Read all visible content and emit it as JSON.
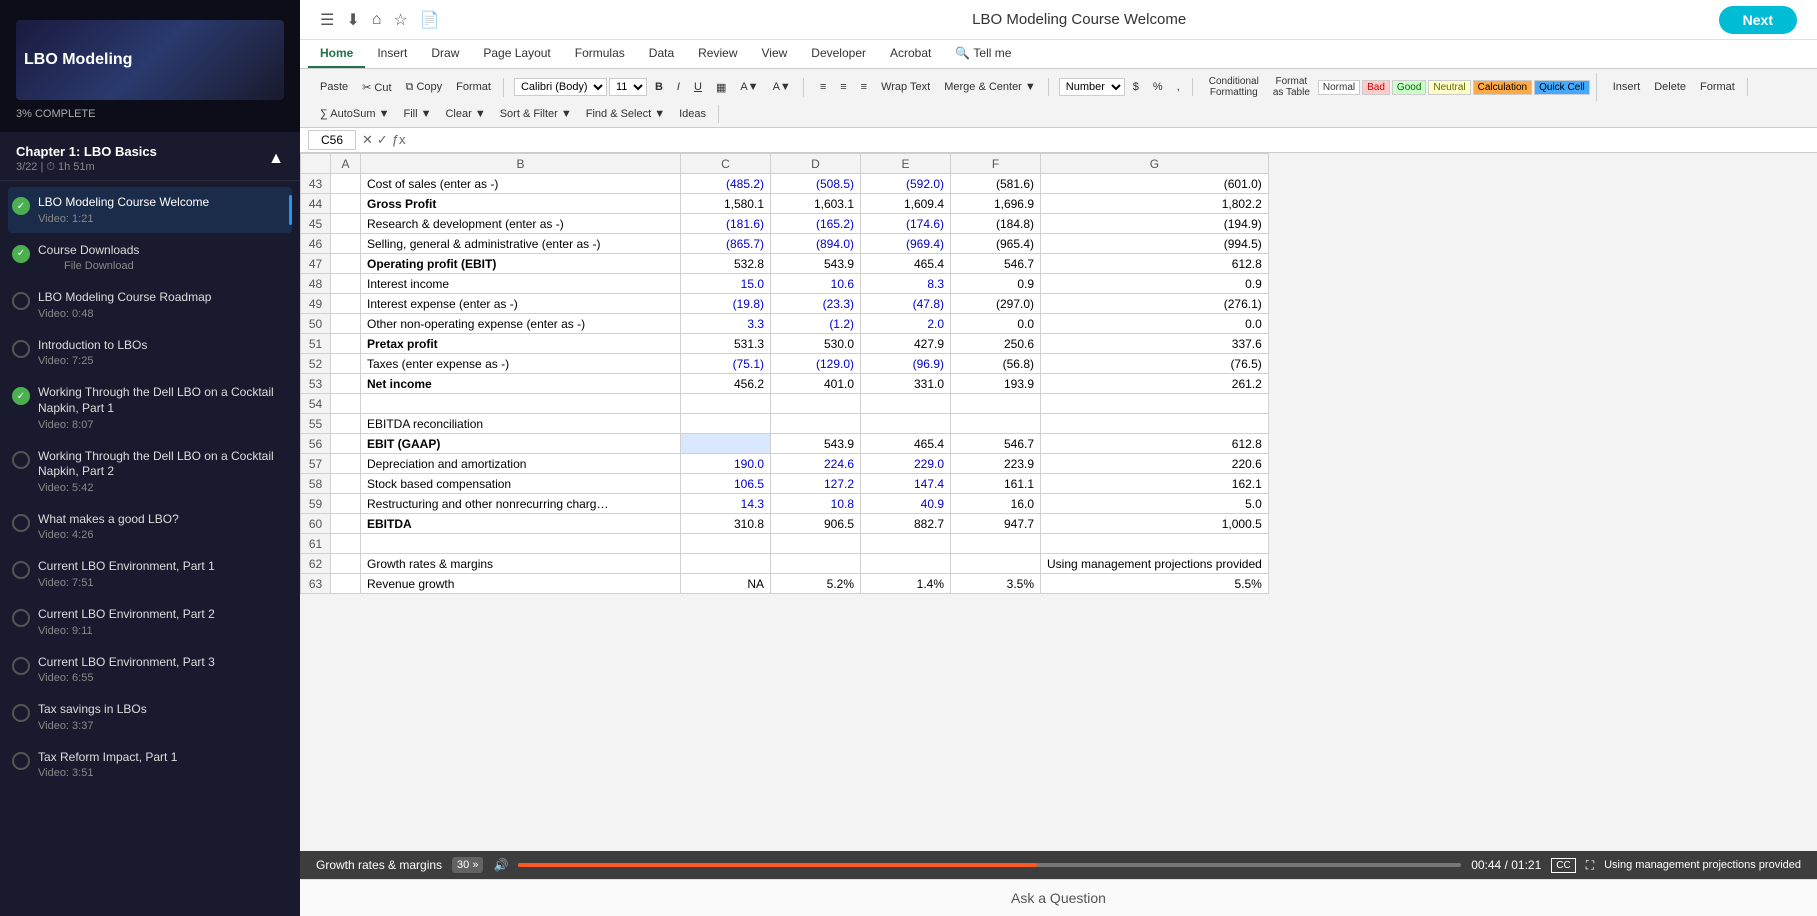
{
  "sidebar": {
    "course_title": "LBO Modeling",
    "progress": "3% COMPLETE",
    "chapter": {
      "title": "Chapter 1: LBO Basics",
      "meta": "3/22  |  ⏱ 1h 51m"
    },
    "lessons": [
      {
        "name": "LBO Modeling Course Welcome",
        "sub": "Video: 1:21",
        "status": "completed",
        "active": true
      },
      {
        "name": "Course Downloads",
        "sub": "File Download",
        "status": "completed",
        "active": false
      },
      {
        "name": "LBO Modeling Course Roadmap",
        "sub": "Video: 0:48",
        "status": "incomplete",
        "active": false
      },
      {
        "name": "Introduction to LBOs",
        "sub": "Video: 7:25",
        "status": "incomplete",
        "active": false
      },
      {
        "name": "Working Through the Dell LBO on a Cocktail Napkin, Part 1",
        "sub": "Video: 8:07",
        "status": "completed",
        "active": false
      },
      {
        "name": "Working Through the Dell LBO on a Cocktail Napkin, Part 2",
        "sub": "Video: 5:42",
        "status": "incomplete",
        "active": false
      },
      {
        "name": "What makes a good LBO?",
        "sub": "Video: 4:26",
        "status": "incomplete",
        "active": false
      },
      {
        "name": "Current LBO Environment, Part 1",
        "sub": "Video: 7:51",
        "status": "incomplete",
        "active": false
      },
      {
        "name": "Current LBO Environment, Part 2",
        "sub": "Video: 9:11",
        "status": "incomplete",
        "active": false
      },
      {
        "name": "Current LBO Environment, Part 3",
        "sub": "Video: 6:55",
        "status": "incomplete",
        "active": false
      },
      {
        "name": "Tax savings in LBOs",
        "sub": "Video: 3:37",
        "status": "incomplete",
        "active": false
      },
      {
        "name": "Tax Reform Impact, Part 1",
        "sub": "Video: 3:51",
        "status": "incomplete",
        "active": false
      }
    ]
  },
  "topbar": {
    "title": "LBO Modeling Course Welcome",
    "next_label": "Next"
  },
  "ribbon": {
    "tabs": [
      "Home",
      "Insert",
      "Draw",
      "Page Layout",
      "Formulas",
      "Data",
      "Review",
      "View",
      "Developer",
      "Acrobat",
      "Tell me"
    ],
    "active_tab": "Home",
    "cell_ref": "C56",
    "font": "Calibri (Body)",
    "font_size": "11"
  },
  "spreadsheet": {
    "columns": [
      "A",
      "B",
      "C",
      "D",
      "E",
      "F",
      "G"
    ],
    "rows": [
      {
        "row": 43,
        "b": "Cost of sales (enter as -)",
        "c": "(485.2)",
        "d": "(508.5)",
        "e": "(592.0)",
        "f": "(581.6)",
        "g": "(601.0)",
        "c_class": "blue",
        "d_class": "blue",
        "e_class": "blue"
      },
      {
        "row": 44,
        "b": "Gross Profit",
        "c": "1,580.1",
        "d": "1,603.1",
        "e": "1,609.4",
        "f": "1,696.9",
        "g": "1,802.2",
        "b_class": "bold"
      },
      {
        "row": 45,
        "b": "Research & development (enter as -)",
        "c": "(181.6)",
        "d": "(165.2)",
        "e": "(174.6)",
        "f": "(184.8)",
        "g": "(194.9)",
        "c_class": "blue",
        "d_class": "blue",
        "e_class": "blue"
      },
      {
        "row": 46,
        "b": "Selling, general & administrative (enter as -)",
        "c": "(865.7)",
        "d": "(894.0)",
        "e": "(969.4)",
        "f": "(965.4)",
        "g": "(994.5)",
        "c_class": "blue",
        "d_class": "blue",
        "e_class": "blue"
      },
      {
        "row": 47,
        "b": "Operating profit (EBIT)",
        "c": "532.8",
        "d": "543.9",
        "e": "465.4",
        "f": "546.7",
        "g": "612.8",
        "b_class": "bold"
      },
      {
        "row": 48,
        "b": "Interest income",
        "c": "15.0",
        "d": "10.6",
        "e": "8.3",
        "f": "0.9",
        "g": "0.9",
        "c_class": "blue",
        "d_class": "blue",
        "e_class": "blue"
      },
      {
        "row": 49,
        "b": "Interest expense (enter as -)",
        "c": "(19.8)",
        "d": "(23.3)",
        "e": "(47.8)",
        "f": "(297.0)",
        "g": "(276.1)",
        "c_class": "blue",
        "d_class": "blue",
        "e_class": "blue"
      },
      {
        "row": 50,
        "b": "Other non-operating expense (enter as -)",
        "c": "3.3",
        "d": "(1.2)",
        "e": "2.0",
        "f": "0.0",
        "g": "0.0",
        "c_class": "blue",
        "d_class": "blue",
        "e_class": "blue"
      },
      {
        "row": 51,
        "b": "Pretax profit",
        "c": "531.3",
        "d": "530.0",
        "e": "427.9",
        "f": "250.6",
        "g": "337.6",
        "b_class": "bold"
      },
      {
        "row": 52,
        "b": "Taxes (enter expense as -)",
        "c": "(75.1)",
        "d": "(129.0)",
        "e": "(96.9)",
        "f": "(56.8)",
        "g": "(76.5)",
        "c_class": "blue",
        "d_class": "blue",
        "e_class": "blue"
      },
      {
        "row": 53,
        "b": "Net income",
        "c": "456.2",
        "d": "401.0",
        "e": "331.0",
        "f": "193.9",
        "g": "261.2",
        "b_class": "bold"
      },
      {
        "row": 54,
        "b": "",
        "c": "",
        "d": "",
        "e": "",
        "f": "",
        "g": ""
      },
      {
        "row": 55,
        "b": "EBITDA reconciliation",
        "c": "",
        "d": "",
        "e": "",
        "f": "",
        "g": ""
      },
      {
        "row": 56,
        "b": "EBIT (GAAP)",
        "c": "",
        "d": "543.9",
        "e": "465.4",
        "f": "546.7",
        "g": "612.8",
        "b_class": "bold",
        "c_selected": true
      },
      {
        "row": 57,
        "b": "  Depreciation and amortization",
        "c": "190.0",
        "d": "224.6",
        "e": "229.0",
        "f": "223.9",
        "g": "220.6",
        "c_class": "blue",
        "d_class": "blue",
        "e_class": "blue"
      },
      {
        "row": 58,
        "b": "  Stock based compensation",
        "c": "106.5",
        "d": "127.2",
        "e": "147.4",
        "f": "161.1",
        "g": "162.1",
        "c_class": "blue",
        "d_class": "blue",
        "e_class": "blue"
      },
      {
        "row": 59,
        "b": "  Restructuring and other nonrecurring charg…",
        "c": "14.3",
        "d": "10.8",
        "e": "40.9",
        "f": "16.0",
        "g": "5.0",
        "c_class": "blue",
        "d_class": "blue",
        "e_class": "blue"
      },
      {
        "row": 60,
        "b": "EBITDA",
        "c": "310.8",
        "d": "906.5",
        "e": "882.7",
        "f": "947.7",
        "g": "1,000.5",
        "b_class": "bold"
      },
      {
        "row": 61,
        "b": "",
        "c": "",
        "d": "",
        "e": "",
        "f": "",
        "g": ""
      },
      {
        "row": 62,
        "b": "Growth rates & margins",
        "c": "",
        "d": "",
        "e": "",
        "f": "",
        "g": "Using management projections provided"
      },
      {
        "row": 63,
        "b": "Revenue growth",
        "c": "NA",
        "d": "5.2%",
        "e": "1.4%",
        "f": "3.5%",
        "g": "5.5%"
      }
    ]
  },
  "video": {
    "title": "Growth rates & margins",
    "skip": "30 »",
    "volume_icon": "🔊",
    "time": "00:44 / 01:21",
    "cc_icon": "CC",
    "right_text": "Using management projections provided"
  },
  "ask": "Ask a Question"
}
